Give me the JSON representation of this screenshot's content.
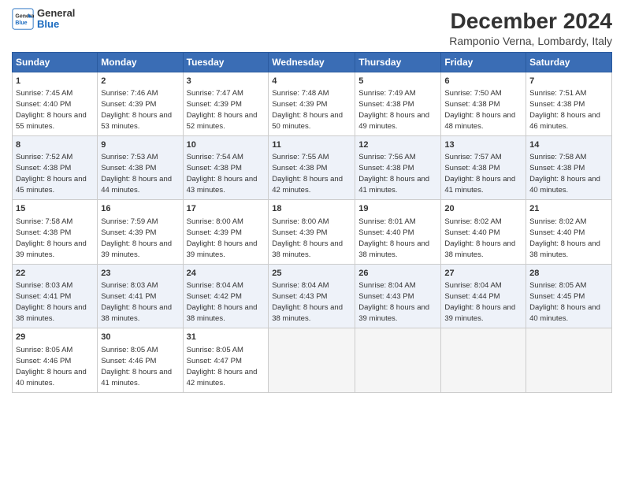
{
  "header": {
    "logo_line1": "General",
    "logo_line2": "Blue",
    "main_title": "December 2024",
    "sub_title": "Ramponio Verna, Lombardy, Italy"
  },
  "days_of_week": [
    "Sunday",
    "Monday",
    "Tuesday",
    "Wednesday",
    "Thursday",
    "Friday",
    "Saturday"
  ],
  "weeks": [
    [
      {
        "day": 1,
        "sunrise": "7:45 AM",
        "sunset": "4:40 PM",
        "daylight": "8 hours and 55 minutes."
      },
      {
        "day": 2,
        "sunrise": "7:46 AM",
        "sunset": "4:39 PM",
        "daylight": "8 hours and 53 minutes."
      },
      {
        "day": 3,
        "sunrise": "7:47 AM",
        "sunset": "4:39 PM",
        "daylight": "8 hours and 52 minutes."
      },
      {
        "day": 4,
        "sunrise": "7:48 AM",
        "sunset": "4:39 PM",
        "daylight": "8 hours and 50 minutes."
      },
      {
        "day": 5,
        "sunrise": "7:49 AM",
        "sunset": "4:38 PM",
        "daylight": "8 hours and 49 minutes."
      },
      {
        "day": 6,
        "sunrise": "7:50 AM",
        "sunset": "4:38 PM",
        "daylight": "8 hours and 48 minutes."
      },
      {
        "day": 7,
        "sunrise": "7:51 AM",
        "sunset": "4:38 PM",
        "daylight": "8 hours and 46 minutes."
      }
    ],
    [
      {
        "day": 8,
        "sunrise": "7:52 AM",
        "sunset": "4:38 PM",
        "daylight": "8 hours and 45 minutes."
      },
      {
        "day": 9,
        "sunrise": "7:53 AM",
        "sunset": "4:38 PM",
        "daylight": "8 hours and 44 minutes."
      },
      {
        "day": 10,
        "sunrise": "7:54 AM",
        "sunset": "4:38 PM",
        "daylight": "8 hours and 43 minutes."
      },
      {
        "day": 11,
        "sunrise": "7:55 AM",
        "sunset": "4:38 PM",
        "daylight": "8 hours and 42 minutes."
      },
      {
        "day": 12,
        "sunrise": "7:56 AM",
        "sunset": "4:38 PM",
        "daylight": "8 hours and 41 minutes."
      },
      {
        "day": 13,
        "sunrise": "7:57 AM",
        "sunset": "4:38 PM",
        "daylight": "8 hours and 41 minutes."
      },
      {
        "day": 14,
        "sunrise": "7:58 AM",
        "sunset": "4:38 PM",
        "daylight": "8 hours and 40 minutes."
      }
    ],
    [
      {
        "day": 15,
        "sunrise": "7:58 AM",
        "sunset": "4:38 PM",
        "daylight": "8 hours and 39 minutes."
      },
      {
        "day": 16,
        "sunrise": "7:59 AM",
        "sunset": "4:39 PM",
        "daylight": "8 hours and 39 minutes."
      },
      {
        "day": 17,
        "sunrise": "8:00 AM",
        "sunset": "4:39 PM",
        "daylight": "8 hours and 39 minutes."
      },
      {
        "day": 18,
        "sunrise": "8:00 AM",
        "sunset": "4:39 PM",
        "daylight": "8 hours and 38 minutes."
      },
      {
        "day": 19,
        "sunrise": "8:01 AM",
        "sunset": "4:40 PM",
        "daylight": "8 hours and 38 minutes."
      },
      {
        "day": 20,
        "sunrise": "8:02 AM",
        "sunset": "4:40 PM",
        "daylight": "8 hours and 38 minutes."
      },
      {
        "day": 21,
        "sunrise": "8:02 AM",
        "sunset": "4:40 PM",
        "daylight": "8 hours and 38 minutes."
      }
    ],
    [
      {
        "day": 22,
        "sunrise": "8:03 AM",
        "sunset": "4:41 PM",
        "daylight": "8 hours and 38 minutes."
      },
      {
        "day": 23,
        "sunrise": "8:03 AM",
        "sunset": "4:41 PM",
        "daylight": "8 hours and 38 minutes."
      },
      {
        "day": 24,
        "sunrise": "8:04 AM",
        "sunset": "4:42 PM",
        "daylight": "8 hours and 38 minutes."
      },
      {
        "day": 25,
        "sunrise": "8:04 AM",
        "sunset": "4:43 PM",
        "daylight": "8 hours and 38 minutes."
      },
      {
        "day": 26,
        "sunrise": "8:04 AM",
        "sunset": "4:43 PM",
        "daylight": "8 hours and 39 minutes."
      },
      {
        "day": 27,
        "sunrise": "8:04 AM",
        "sunset": "4:44 PM",
        "daylight": "8 hours and 39 minutes."
      },
      {
        "day": 28,
        "sunrise": "8:05 AM",
        "sunset": "4:45 PM",
        "daylight": "8 hours and 40 minutes."
      }
    ],
    [
      {
        "day": 29,
        "sunrise": "8:05 AM",
        "sunset": "4:46 PM",
        "daylight": "8 hours and 40 minutes."
      },
      {
        "day": 30,
        "sunrise": "8:05 AM",
        "sunset": "4:46 PM",
        "daylight": "8 hours and 41 minutes."
      },
      {
        "day": 31,
        "sunrise": "8:05 AM",
        "sunset": "4:47 PM",
        "daylight": "8 hours and 42 minutes."
      },
      null,
      null,
      null,
      null
    ]
  ]
}
